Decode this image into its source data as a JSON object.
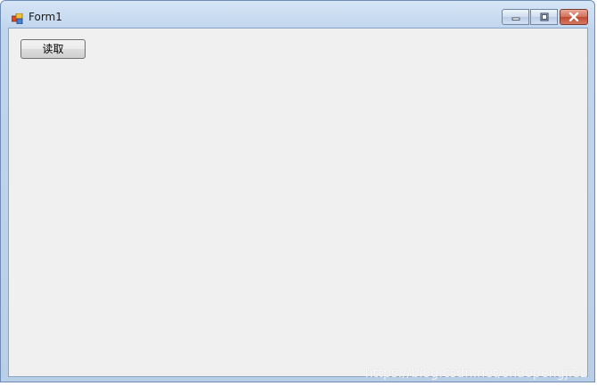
{
  "window": {
    "title": "Form1",
    "icon": "winforms-app-icon",
    "controls": {
      "minimize": "minimize-icon",
      "maximize": "maximize-icon",
      "close": "close-icon"
    }
  },
  "form": {
    "read_button_label": "读取"
  },
  "watermark": "https://blog.csdn.net/shaopengjie2",
  "colors": {
    "title_bar": "#c1d6ee",
    "client_background": "#f0f0f0",
    "close_button": "#c04a32"
  }
}
